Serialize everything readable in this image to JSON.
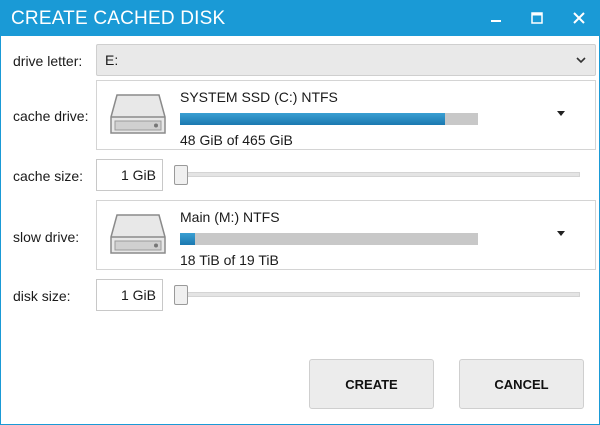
{
  "window": {
    "title": "CREATE CACHED DISK"
  },
  "titlebar_buttons": {
    "minimize_icon": "minimize-icon",
    "maximize_icon": "maximize-icon",
    "close_icon": "close-icon"
  },
  "drive_letter": {
    "label": "drive letter:",
    "value": "E:"
  },
  "cache_drive": {
    "label": "cache drive:",
    "name": "SYSTEM SSD (C:) NTFS",
    "usage_text": "48 GiB of 465 GiB",
    "used_fraction": 0.89
  },
  "cache_size": {
    "label": "cache size:",
    "value": "1 GiB",
    "slider_fraction": 0.0
  },
  "slow_drive": {
    "label": "slow drive:",
    "name": "Main (M:) NTFS",
    "usage_text": "18 TiB of 19 TiB",
    "used_fraction": 0.05
  },
  "disk_size": {
    "label": "disk size:",
    "value": "1 GiB",
    "slider_fraction": 0.0
  },
  "buttons": {
    "create": "CREATE",
    "cancel": "CANCEL"
  },
  "colors": {
    "accent": "#1a9ad6",
    "bar_fill": "#1a78b0",
    "bar_track": "#c8c8c8"
  }
}
